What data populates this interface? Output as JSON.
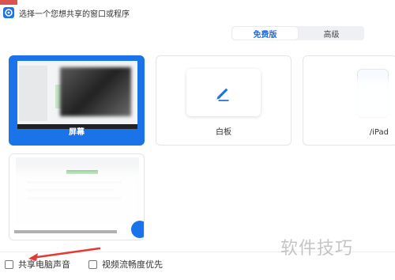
{
  "window": {
    "title": "选择一个您想共享的窗口或程序"
  },
  "tabs": [
    {
      "label": "免费版",
      "active": true
    },
    {
      "label": "高级",
      "active": false
    }
  ],
  "cards": {
    "screen": {
      "label": "屏幕"
    },
    "whiteboard": {
      "label": "白板"
    },
    "ipad": {
      "label": "/iPad"
    }
  },
  "options": {
    "share_audio": {
      "label": "共享电脑声音",
      "checked": false
    },
    "video_smooth": {
      "label": "视频流畅度优先",
      "checked": false
    }
  },
  "watermark": "软件技巧",
  "colors": {
    "accent": "#1a73e8",
    "tab_active_text": "#1f6fe5",
    "annotation_arrow": "#e53935"
  },
  "icons": {
    "app": "meeting-app-icon",
    "whiteboard": "pencil-icon"
  }
}
